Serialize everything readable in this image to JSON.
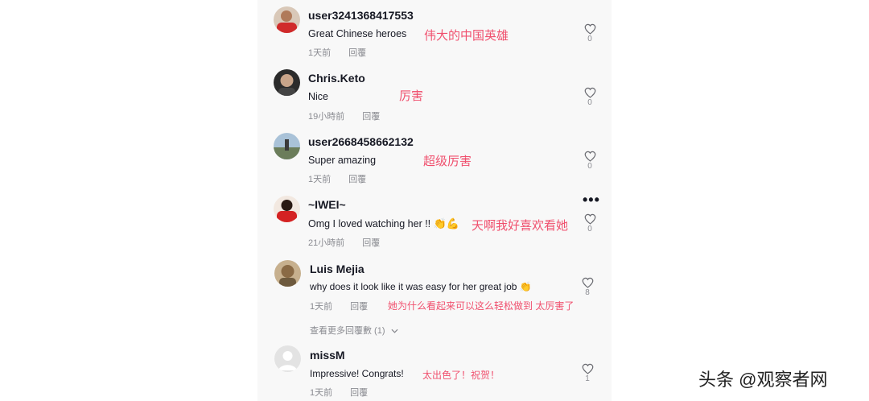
{
  "comments": [
    {
      "username": "user3241368417553",
      "text": "Great Chinese heroes",
      "translation": "伟大的中国英雄",
      "time": "1天前",
      "reply": "回覆",
      "likes": "0"
    },
    {
      "username": "Chris.Keto",
      "text": "Nice",
      "translation": "厉害",
      "time": "19小時前",
      "reply": "回覆",
      "likes": "0"
    },
    {
      "username": "user2668458662132",
      "text": "Super amazing",
      "translation": "超级厉害",
      "time": "1天前",
      "reply": "回覆",
      "likes": "0"
    },
    {
      "username": "~IWEI~",
      "text": "Omg I loved watching her !!",
      "translation": "天啊我好喜欢看她",
      "time": "21小時前",
      "reply": "回覆",
      "likes": "0"
    },
    {
      "username": "Luis Mejia",
      "text": "why does it look like it was easy for her great job",
      "translation": "她为什么看起来可以这么轻松做到  太厉害了",
      "time": "1天前",
      "reply": "回覆",
      "likes": "8"
    },
    {
      "username": "missM",
      "text": "Impressive! Congrats!",
      "translation": "太出色了！祝贺！",
      "time": "1天前",
      "reply": "回覆",
      "likes": "1"
    }
  ],
  "view_more": "查看更多回覆數 (1)",
  "watermark": "头条 @观察者网",
  "icons": {
    "like": "heart-outline-icon",
    "more": "more-options-icon",
    "expand": "chevron-down-icon"
  },
  "colors": {
    "translation": "#f0506e",
    "meta": "#8a8b91",
    "text": "#161823"
  }
}
